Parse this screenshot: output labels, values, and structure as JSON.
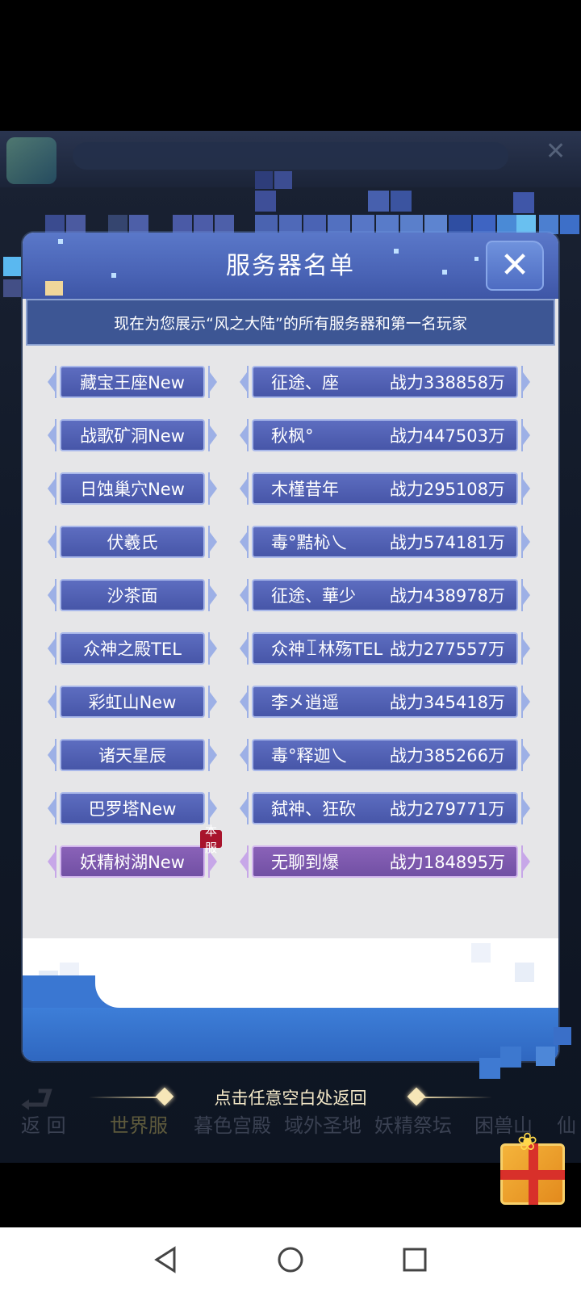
{
  "modal": {
    "title": "服务器名单",
    "subtitle": "现在为您展示“风之大陆”的所有服务器和第一名玩家",
    "close_icon": "close-x-icon"
  },
  "servers": [
    {
      "server": "藏宝王座New",
      "player": "征途、座",
      "power": "战力338858万"
    },
    {
      "server": "战歌矿洞New",
      "player": "秋枫°",
      "power": "战力447503万"
    },
    {
      "server": "日蚀巢穴New",
      "player": "木槿昔年",
      "power": "战力295108万"
    },
    {
      "server": "伏羲氏",
      "player": "毒°黠杺乀",
      "power": "战力574181万"
    },
    {
      "server": "沙茶面",
      "player": "征途、華少",
      "power": "战力438978万"
    },
    {
      "server": "众神之殿TEL",
      "player": "众神ꀤ林殇TEL",
      "power": "战力277557万"
    },
    {
      "server": "彩虹山New",
      "player": "李㐅逍遥",
      "power": "战力345418万"
    },
    {
      "server": "诸天星辰",
      "player": "毒°释迦乀",
      "power": "战力385266万"
    },
    {
      "server": "巴罗塔New",
      "player": "弑神、狂砍",
      "power": "战力279771万"
    },
    {
      "server": "妖精树湖New",
      "player": "无聊到爆",
      "power": "战力184895万",
      "current": true,
      "badge": "本服"
    }
  ],
  "hint": {
    "text": "点击任意空白处返回"
  },
  "bottom_nav": {
    "items": [
      "返 回",
      "世界服",
      "暮色宫殿",
      "域外圣地",
      "妖精祭坛",
      "困兽山",
      "仙"
    ]
  },
  "colors": {
    "header_blue": "#4a64b6",
    "button_blue": "#4f5fb2",
    "button_current": "#7a56ab",
    "badge_red": "#a8142c"
  }
}
